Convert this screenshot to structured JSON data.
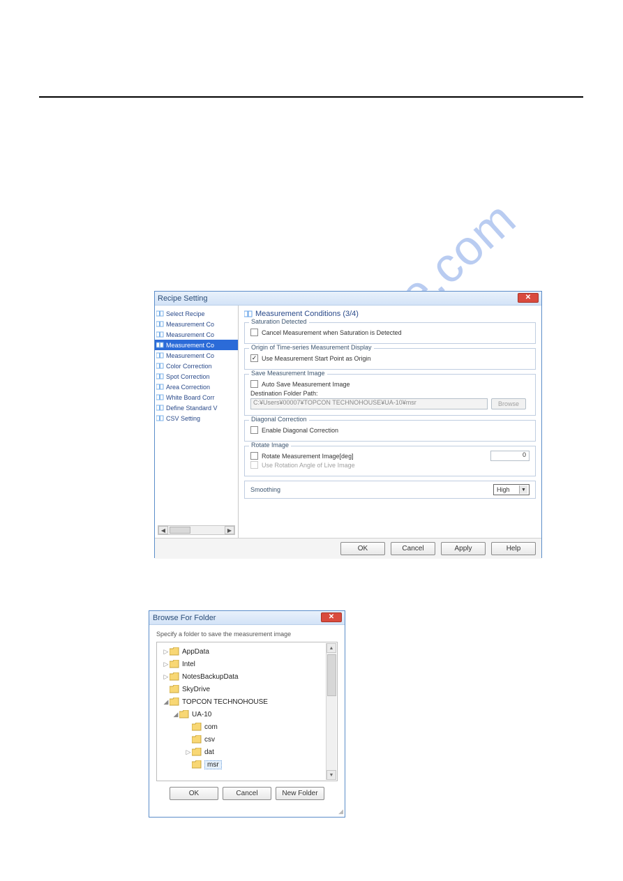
{
  "watermark": "manualshive.com",
  "recipe_window": {
    "title": "Recipe Setting",
    "tree": {
      "items": [
        "Select Recipe",
        "Measurement Co",
        "Measurement Co",
        "Measurement Co",
        "Measurement Co",
        "Color Correction",
        "Spot Correction",
        "Area Correction",
        "White Board Corr",
        "Define Standard V",
        "CSV Setting"
      ],
      "selected_index": 3
    },
    "panel_title": "Measurement Conditions (3/4)",
    "groups": {
      "saturation": {
        "title": "Saturation Detected",
        "opt1_label": "Cancel Measurement when Saturation is Detected",
        "opt1_checked": false
      },
      "origin": {
        "title": "Origin of Time-series Measurement Display",
        "opt1_label": "Use Measurement Start Point as Origin",
        "opt1_checked": true
      },
      "save": {
        "title": "Save Measurement Image",
        "auto_label": "Auto Save Measurement Image",
        "auto_checked": false,
        "path_label": "Destination Folder Path:",
        "path_value": "C:¥Users¥00007¥TOPCON TECHNOHOUSE¥UA-10¥msr",
        "browse_label": "Browse"
      },
      "diagonal": {
        "title": "Diagonal Correction",
        "opt1_label": "Enable Diagonal Correction",
        "opt1_checked": false
      },
      "rotate": {
        "title": "Rotate Image",
        "opt1_label": "Rotate Measurement Image[deg]",
        "opt1_checked": false,
        "opt2_label": "Use Rotation Angle of Live Image",
        "opt2_disabled": true,
        "angle_value": "0"
      },
      "smoothing": {
        "title": "Smoothing",
        "value": "High"
      }
    },
    "buttons": {
      "ok": "OK",
      "cancel": "Cancel",
      "apply": "Apply",
      "help": "Help"
    }
  },
  "browse_window": {
    "title": "Browse For Folder",
    "instruction": "Specify a folder to save the measurement image",
    "tree": [
      {
        "label": "AppData",
        "level": 0,
        "exp": "▷"
      },
      {
        "label": "Intel",
        "level": 0,
        "exp": "▷"
      },
      {
        "label": "NotesBackupData",
        "level": 0,
        "exp": "▷"
      },
      {
        "label": "SkyDrive",
        "level": 0,
        "exp": ""
      },
      {
        "label": "TOPCON TECHNOHOUSE",
        "level": 0,
        "exp": "◢"
      },
      {
        "label": "UA-10",
        "level": 1,
        "exp": "◢"
      },
      {
        "label": "com",
        "level": 2,
        "exp": ""
      },
      {
        "label": "csv",
        "level": 2,
        "exp": ""
      },
      {
        "label": "dat",
        "level": 2,
        "exp": "▷"
      },
      {
        "label": "msr",
        "level": 2,
        "exp": "",
        "selected": true
      }
    ],
    "buttons": {
      "ok": "OK",
      "cancel": "Cancel",
      "newfolder": "New Folder"
    }
  }
}
